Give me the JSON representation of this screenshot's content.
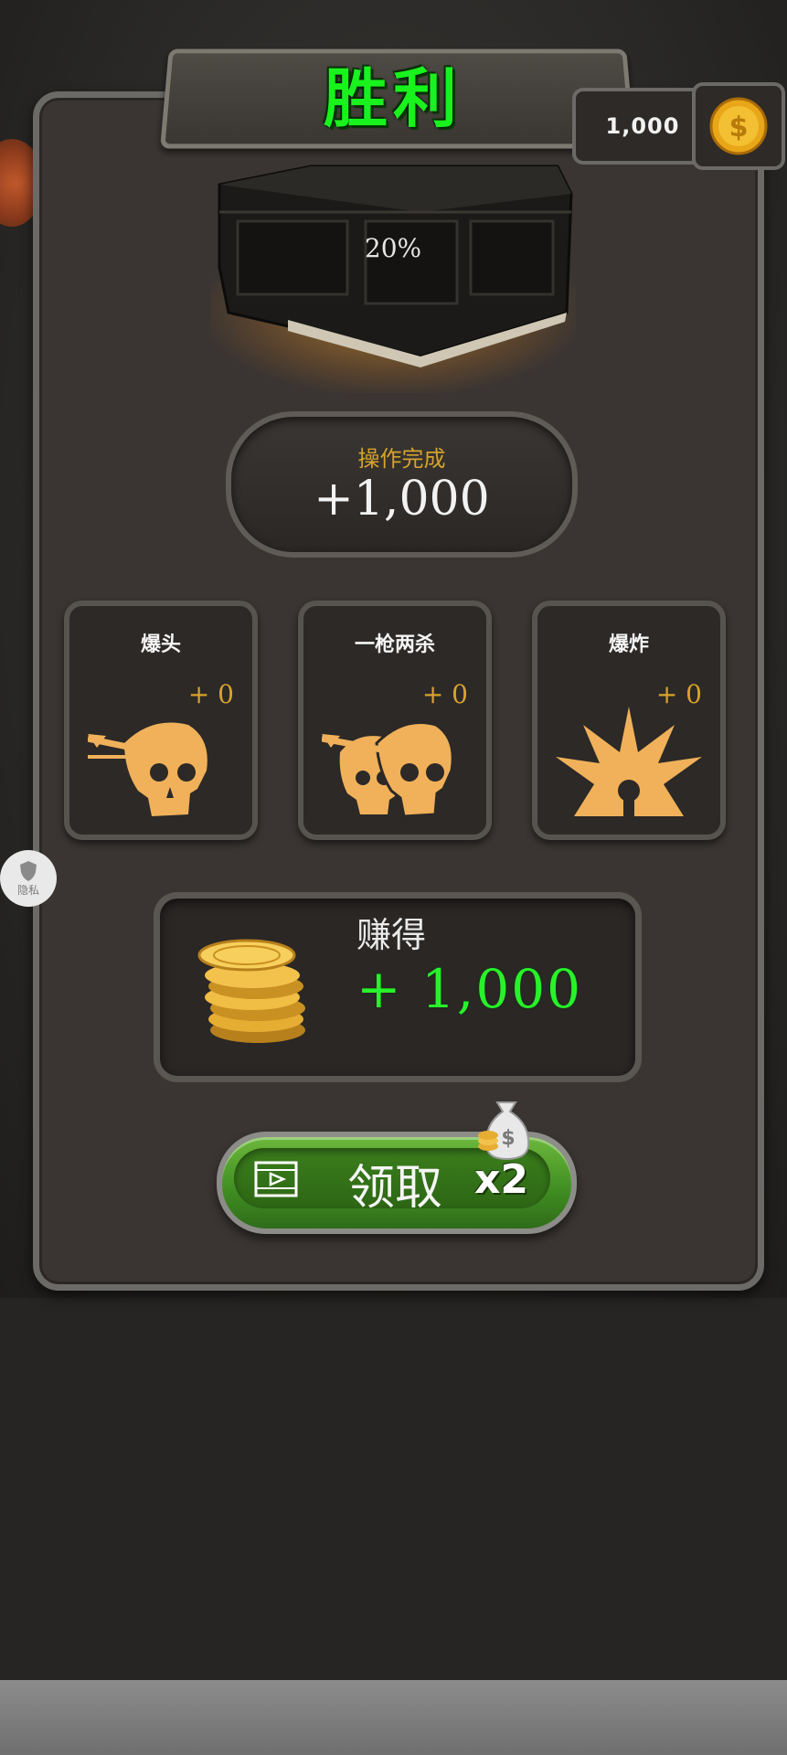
{
  "header": {
    "title": "胜利"
  },
  "currency": {
    "amount": "1,000",
    "icon": "gold-coin-icon"
  },
  "chest": {
    "progress_text": "20%",
    "progress": 0.2
  },
  "operation": {
    "label": "操作完成",
    "value": "+1,000"
  },
  "stats": [
    {
      "title": "爆头",
      "plus": "+ 0",
      "icon": "headshot-skull-icon"
    },
    {
      "title": "一枪两杀",
      "plus": "+ 0",
      "icon": "double-kill-skull-icon"
    },
    {
      "title": "爆炸",
      "plus": "+ 0",
      "icon": "explosion-icon"
    }
  ],
  "earned": {
    "label": "赚得",
    "value": "+ 1,000"
  },
  "claim": {
    "label": "领取",
    "multiplier": "x2"
  },
  "privacy": {
    "label": "隐私"
  },
  "colors": {
    "title_green": "#19f21d",
    "gold": "#d9a22c",
    "earn_green": "#28f22a",
    "button_green": "#4f9d2c",
    "panel": "#3a3532"
  }
}
